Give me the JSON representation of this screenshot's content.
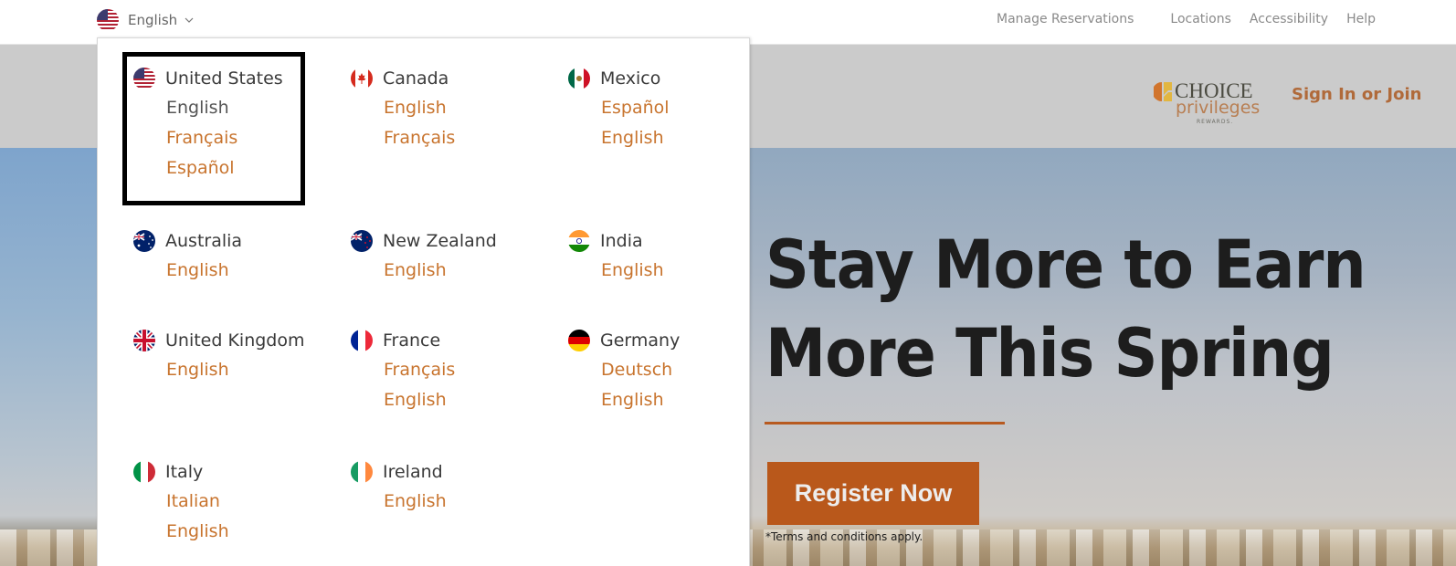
{
  "topbar": {
    "language_toggle": {
      "label": "English",
      "flag": "us-flag-icon"
    },
    "nav": [
      {
        "label": "Manage Reservations"
      },
      {
        "label": "Locations"
      },
      {
        "label": "Accessibility"
      },
      {
        "label": "Help"
      }
    ]
  },
  "header": {
    "logo": {
      "line1": "CHOICE",
      "line2": "privileges",
      "line3": "REWARDS."
    },
    "signin_label": "Sign In or Join"
  },
  "hero": {
    "headline_line1": "Stay More to Earn",
    "headline_line2": "More This Spring",
    "cta_label": "Register Now",
    "terms": "*Terms and conditions apply."
  },
  "dropdown": {
    "countries": [
      {
        "name": "United States",
        "flag": "us-flag-icon",
        "languages": [
          "English",
          "Français",
          "Español"
        ],
        "current": "English",
        "highlighted": true
      },
      {
        "name": "Canada",
        "flag": "canada-flag-icon",
        "languages": [
          "English",
          "Français"
        ]
      },
      {
        "name": "Mexico",
        "flag": "mexico-flag-icon",
        "languages": [
          "Español",
          "English"
        ]
      },
      {
        "name": "Australia",
        "flag": "australia-flag-icon",
        "languages": [
          "English"
        ]
      },
      {
        "name": "New Zealand",
        "flag": "new-zealand-flag-icon",
        "languages": [
          "English"
        ]
      },
      {
        "name": "India",
        "flag": "india-flag-icon",
        "languages": [
          "English"
        ]
      },
      {
        "name": "United Kingdom",
        "flag": "uk-flag-icon",
        "languages": [
          "English"
        ]
      },
      {
        "name": "France",
        "flag": "france-flag-icon",
        "languages": [
          "Français",
          "English"
        ]
      },
      {
        "name": "Germany",
        "flag": "germany-flag-icon",
        "languages": [
          "Deutsch",
          "English"
        ]
      },
      {
        "name": "Italy",
        "flag": "italy-flag-icon",
        "languages": [
          "Italian",
          "English"
        ]
      },
      {
        "name": "Ireland",
        "flag": "ireland-flag-icon",
        "languages": [
          "English"
        ]
      }
    ]
  },
  "colors": {
    "accent": "#c8742e",
    "cta": "#b9581b",
    "headline": "#1d1d1d"
  }
}
